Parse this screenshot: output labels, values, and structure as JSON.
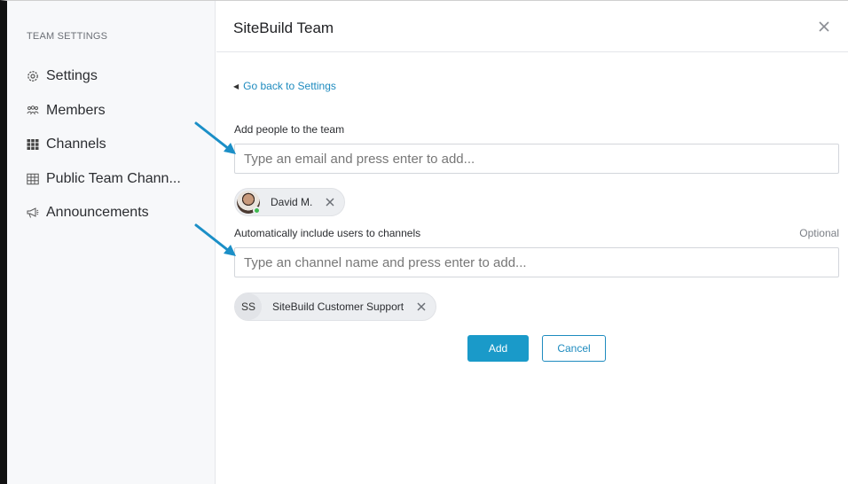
{
  "sidebar": {
    "heading": "TEAM SETTINGS",
    "items": [
      {
        "label": "Settings",
        "icon": "gear-icon"
      },
      {
        "label": "Members",
        "icon": "members-icon"
      },
      {
        "label": "Channels",
        "icon": "channels-grid-icon"
      },
      {
        "label": "Public Team Chann...",
        "icon": "table-icon"
      },
      {
        "label": "Announcements",
        "icon": "megaphone-icon"
      }
    ]
  },
  "header": {
    "title": "SiteBuild Team",
    "close_icon": "close-icon"
  },
  "main": {
    "back_link": "Go back to Settings",
    "people": {
      "label": "Add people to the team",
      "placeholder": "Type an email and press enter to add...",
      "chips": [
        {
          "label": "David M.",
          "status": "online"
        }
      ]
    },
    "channels": {
      "label": "Automatically include users to channels",
      "optional": "Optional",
      "placeholder": "Type an channel name and press enter to add...",
      "chips": [
        {
          "initials": "SS",
          "label": "SiteBuild Customer Support"
        }
      ]
    },
    "add_label": "Add",
    "cancel_label": "Cancel"
  },
  "colors": {
    "accent": "#1a9ac9",
    "link": "#1e8bbf",
    "arrow": "#1b8fc7",
    "online": "#3fb950",
    "sidebar_bg": "#f7f8fa"
  }
}
